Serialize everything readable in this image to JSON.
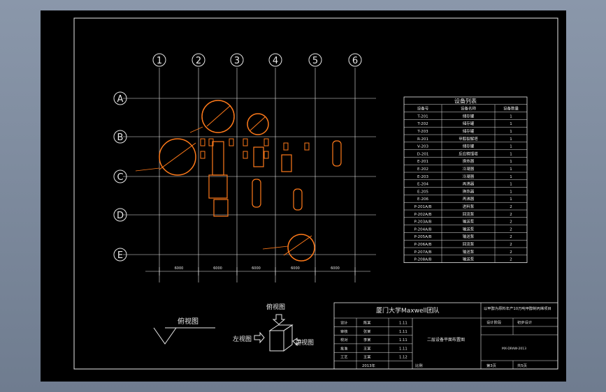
{
  "grid": {
    "columns": [
      "1",
      "2",
      "3",
      "4",
      "5",
      "6"
    ],
    "rows": [
      "A",
      "B",
      "C",
      "D",
      "E"
    ],
    "dim_label": "6000"
  },
  "equipment_table": {
    "title": "设备列表",
    "headers": [
      "设备号",
      "设备名称",
      "设备数量"
    ],
    "rows": [
      [
        "T-201",
        "储存罐",
        "1"
      ],
      [
        "T-202",
        "储存罐",
        "1"
      ],
      [
        "T-203",
        "储存罐",
        "1"
      ],
      [
        "R-201",
        "甲醇裂解塔",
        "1"
      ],
      [
        "V-203",
        "储存罐",
        "1"
      ],
      [
        "D-201",
        "反应精馏塔",
        "1"
      ],
      [
        "E-201",
        "换热器",
        "1"
      ],
      [
        "E-202",
        "冷凝器",
        "1"
      ],
      [
        "E-203",
        "冷凝器",
        "1"
      ],
      [
        "E-204",
        "再沸器",
        "1"
      ],
      [
        "E-205",
        "换热器",
        "1"
      ],
      [
        "E-206",
        "再沸器",
        "1"
      ],
      [
        "P-201A/B",
        "进料泵",
        "2"
      ],
      [
        "P-202A/B",
        "回流泵",
        "2"
      ],
      [
        "P-203A/B",
        "输送泵",
        "2"
      ],
      [
        "P-204A/B",
        "输送泵",
        "2"
      ],
      [
        "P-205A/B",
        "输送泵",
        "2"
      ],
      [
        "P-206A/B",
        "回流泵",
        "2"
      ],
      [
        "P-207A/B",
        "输送泵",
        "2"
      ],
      [
        "P-208A/B",
        "输送泵",
        "2"
      ]
    ]
  },
  "title_block": {
    "team": "厦门大学Maxwell团队",
    "project": "以甲醇为原料年产10万吨甲醇制丙烯项目",
    "drawing_name": "二层设备平面布置图",
    "rows": [
      [
        "设计",
        "陈某",
        "1.11"
      ],
      [
        "审核",
        "张某",
        "1.11"
      ],
      [
        "校对",
        "李某",
        "1.11"
      ],
      [
        "批准",
        "王某",
        "1.11"
      ],
      [
        "工艺",
        "王某",
        "1.12"
      ]
    ],
    "year": "2013年",
    "scale": "比例",
    "phase": "设计阶段",
    "stage": "初步设计",
    "drawing_no": "MX-DRAW-2013",
    "sheet": "第3页",
    "total": "共5页"
  },
  "views": {
    "bottom_left": "俯视图",
    "top": "俯视图",
    "left": "左视图",
    "front": "正视图"
  },
  "colors": {
    "lines": "#e8e8e8",
    "equipment": "#ff7a1a",
    "background": "#000000"
  }
}
